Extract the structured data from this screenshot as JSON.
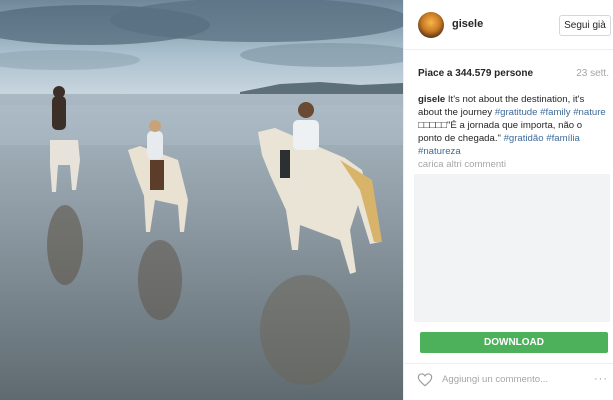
{
  "post": {
    "username": "gisele",
    "follow_label": "Segui già",
    "likes": "Piace a 344.579 persone",
    "date": "23 sett.",
    "caption": {
      "user": "gisele",
      "text1": " It's not about the destination, it's about the journey ",
      "tag_gratitude": "#gratitude",
      "tag_family": "#family",
      "tag_nature": "#nature",
      "text2": " □□□□□\"É a jornada que importa, não o ponto de chegada.\" ",
      "tag_gratidao": "#gratidão",
      "tag_familia": "#família",
      "tag_natureza": "#natureza"
    },
    "load_more": "carica altri commenti",
    "download_label": "DOWNLOAD",
    "comment_placeholder": "Aggiungi un commento...",
    "more_options": "···"
  },
  "icons": {
    "like": "heart-outline-icon",
    "options": "ellipsis-icon"
  },
  "colors": {
    "hashtag": "#3e6b9a",
    "download": "#4cb15a",
    "muted": "#a6a6a6"
  }
}
